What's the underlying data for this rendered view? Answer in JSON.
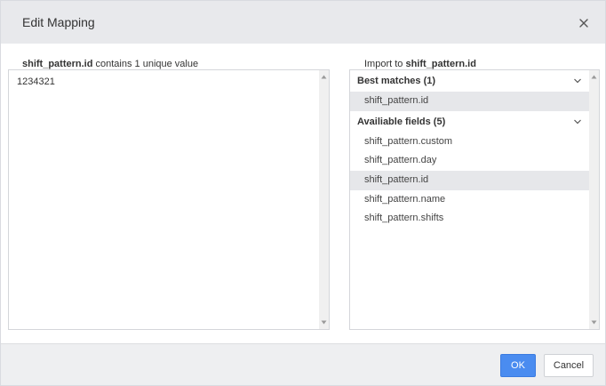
{
  "dialog": {
    "title": "Edit Mapping"
  },
  "source": {
    "field_name": "shift_pattern.id",
    "caption_suffix": " contains 1 unique value",
    "values": [
      "1234321"
    ]
  },
  "target": {
    "caption_prefix": "Import to ",
    "field_name": "shift_pattern.id",
    "best_matches": {
      "label": "Best matches (1)",
      "items": [
        {
          "label": "shift_pattern.id",
          "selected": true
        }
      ]
    },
    "available_fields": {
      "label": "Availiable fields (5)",
      "items": [
        {
          "label": "shift_pattern.custom",
          "selected": false
        },
        {
          "label": "shift_pattern.day",
          "selected": false
        },
        {
          "label": "shift_pattern.id",
          "selected": true
        },
        {
          "label": "shift_pattern.name",
          "selected": false
        },
        {
          "label": "shift_pattern.shifts",
          "selected": false
        }
      ]
    }
  },
  "footer": {
    "ok_label": "OK",
    "cancel_label": "Cancel"
  },
  "icons": {
    "close": "close-icon",
    "chevron": "chevron-down-icon",
    "scroll_up": "scroll-up-arrow-icon",
    "scroll_down": "scroll-down-arrow-icon"
  },
  "colors": {
    "header_bg": "#e8e9ec",
    "selected_bg": "#e6e7ea",
    "primary": "#4a8cf0"
  }
}
